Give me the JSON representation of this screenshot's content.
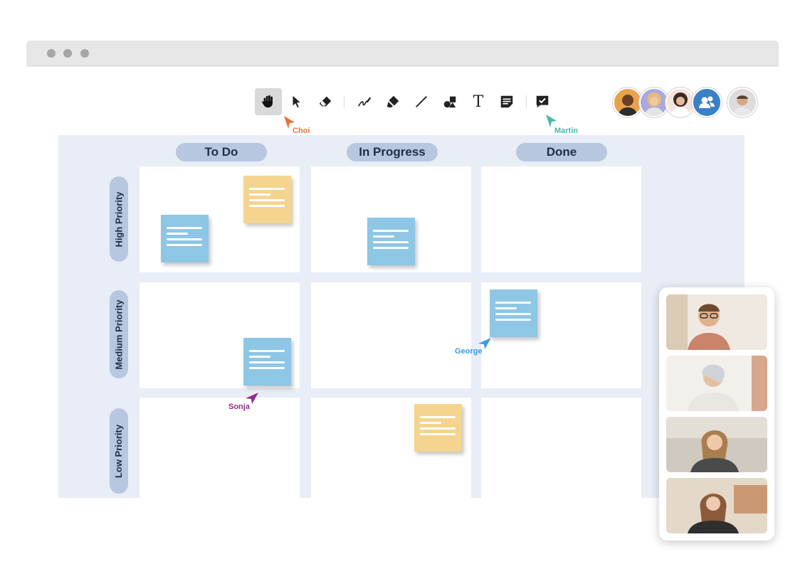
{
  "window": {
    "controls": [
      "close",
      "minimize",
      "maximize"
    ]
  },
  "toolbar": {
    "tools": [
      {
        "name": "hand-icon",
        "active": true
      },
      {
        "name": "select-arrow-icon"
      },
      {
        "name": "eraser-icon"
      },
      {
        "name": "pen-icon"
      },
      {
        "name": "highlighter-icon"
      },
      {
        "name": "line-icon"
      },
      {
        "name": "shapes-icon"
      },
      {
        "name": "text-icon",
        "glyph": "T"
      },
      {
        "name": "sticky-note-icon"
      },
      {
        "name": "comment-check-icon"
      }
    ]
  },
  "participants": {
    "avatars": [
      "participant-1",
      "participant-2",
      "participant-3"
    ],
    "group_icon": "people-icon",
    "self_avatar": "self"
  },
  "board": {
    "columns": [
      "To Do",
      "In Progress",
      "Done"
    ],
    "rows": [
      "High Priority",
      "Medium Priority",
      "Low Priority"
    ],
    "colors": {
      "board_bg": "#e8edf6",
      "header_bg": "#b8c7e0",
      "note_blue": "#8ec6e6",
      "note_yellow": "#f5d48f"
    }
  },
  "cursors": [
    {
      "name": "Choi",
      "color": "#e8743b"
    },
    {
      "name": "Martin",
      "color": "#4db6ac"
    },
    {
      "name": "George",
      "color": "#3b9be0"
    },
    {
      "name": "Sonja",
      "color": "#8e2e8a"
    }
  ],
  "video_call": {
    "tiles": 4
  }
}
